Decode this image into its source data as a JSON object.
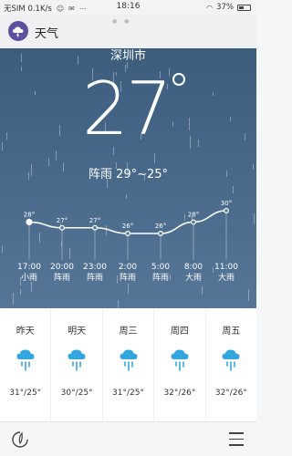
{
  "status_bar": {
    "carrier": "无SIM 0.1K/s",
    "time": "18:16",
    "battery": "37%",
    "battery_level": 0.37
  },
  "app": {
    "title": "天气",
    "icon": "storm-cloud-icon"
  },
  "current": {
    "city": "深圳市",
    "temp": "27",
    "summary": "阵雨 29°~25°"
  },
  "hourly": {
    "points": [
      {
        "temp": 28,
        "label": "28°",
        "time": "17:00",
        "cond": "小雨"
      },
      {
        "temp": 27,
        "label": "27°",
        "time": "20:00",
        "cond": "阵雨"
      },
      {
        "temp": 27,
        "label": "27°",
        "time": "23:00",
        "cond": "阵雨"
      },
      {
        "temp": 26,
        "label": "26°",
        "time": "2:00",
        "cond": "阵雨"
      },
      {
        "temp": 26,
        "label": "26°",
        "time": "5:00",
        "cond": "阵雨"
      },
      {
        "temp": 28,
        "label": "28°",
        "time": "8:00",
        "cond": "大雨"
      },
      {
        "temp": 30,
        "label": "30°",
        "time": "11:00",
        "cond": "大雨"
      }
    ],
    "colors": {
      "line": "#ffffff"
    }
  },
  "daily": [
    {
      "name": "昨天",
      "range": "31°/25°",
      "icon": "rain-icon"
    },
    {
      "name": "明天",
      "range": "30°/25°",
      "icon": "rain-icon"
    },
    {
      "name": "周三",
      "range": "31°/25°",
      "icon": "rain-icon"
    },
    {
      "name": "周四",
      "range": "32°/26°",
      "icon": "rain-icon"
    },
    {
      "name": "周五",
      "range": "32°/26°",
      "icon": "rain-icon"
    }
  ],
  "colors": {
    "rain_icon": "#33a6e0",
    "hero_bg": "#48688a"
  }
}
